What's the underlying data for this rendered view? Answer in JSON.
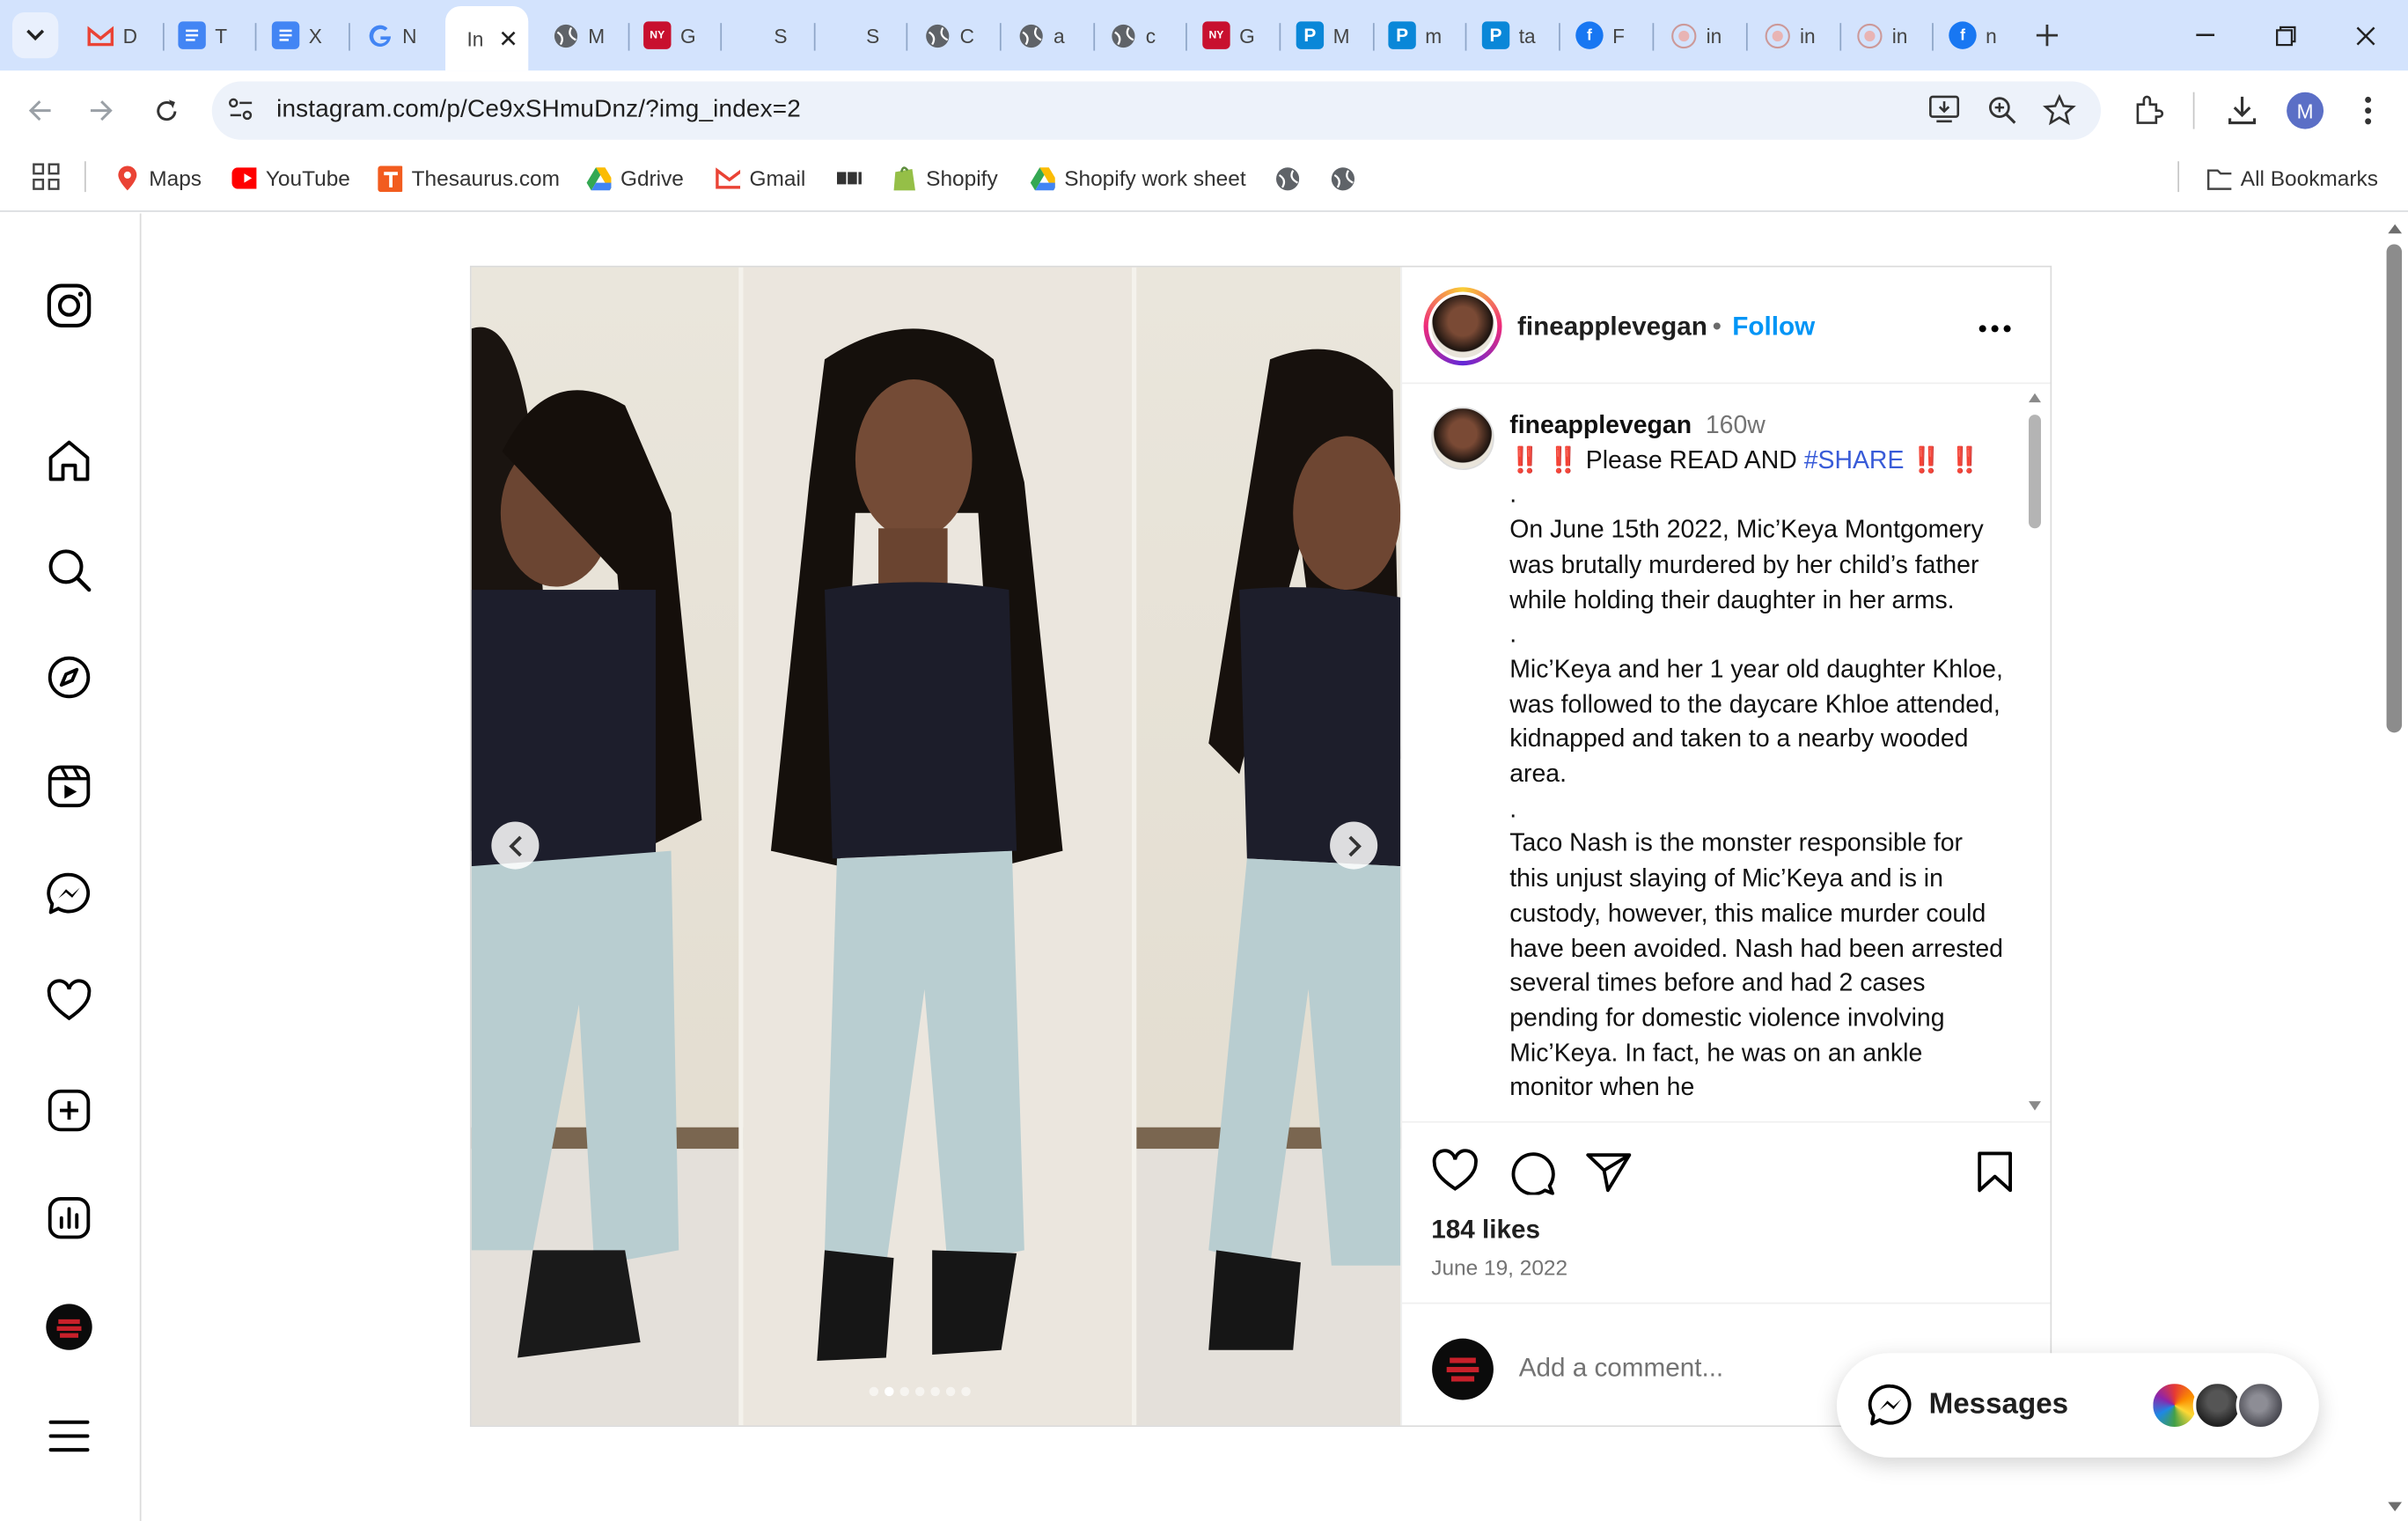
{
  "browser": {
    "tabs": [
      {
        "icon": "gmail-icon",
        "label": "D",
        "color": "#ea4335"
      },
      {
        "icon": "docs-icon",
        "label": "T",
        "color": "#4285f4"
      },
      {
        "icon": "docs-icon",
        "label": "X",
        "color": "#4285f4"
      },
      {
        "icon": "google-icon",
        "label": "N",
        "color": "#4285f4"
      },
      {
        "icon": "instagram-icon",
        "label": "In",
        "color": "#ffffff",
        "active": true
      },
      {
        "icon": "globe-icon",
        "label": "M",
        "color": "#5f6368"
      },
      {
        "icon": "nypost-icon",
        "label": "G",
        "color": "#c8102e"
      },
      {
        "icon": "blank-icon",
        "label": "S",
        "color": "#d3e3fd"
      },
      {
        "icon": "blank-icon",
        "label": "S",
        "color": "#d3e3fd"
      },
      {
        "icon": "globe-icon",
        "label": "C",
        "color": "#5f6368"
      },
      {
        "icon": "globe-icon",
        "label": "a",
        "color": "#5f6368"
      },
      {
        "icon": "globe-icon",
        "label": "c",
        "color": "#5f6368"
      },
      {
        "icon": "nypost-icon",
        "label": "G",
        "color": "#c8102e"
      },
      {
        "icon": "p-icon",
        "label": "M",
        "color": "#0a87d8"
      },
      {
        "icon": "p-icon",
        "label": "m",
        "color": "#0a87d8"
      },
      {
        "icon": "p-icon",
        "label": "ta",
        "color": "#0a87d8"
      },
      {
        "icon": "facebook-icon",
        "label": "F",
        "color": "#1877f2"
      },
      {
        "icon": "ig-gray-icon",
        "label": "in",
        "color": "#e0a0a0"
      },
      {
        "icon": "ig-gray-icon",
        "label": "in",
        "color": "#e0a0a0"
      },
      {
        "icon": "ig-gray-icon",
        "label": "in",
        "color": "#e0a0a0"
      },
      {
        "icon": "facebook-icon",
        "label": "n",
        "color": "#1877f2"
      }
    ],
    "url": "instagram.com/p/Ce9xSHmuDnz/?img_index=2",
    "profile_initial": "M",
    "bookmarks": [
      {
        "icon": "maps-icon",
        "label": "Maps"
      },
      {
        "icon": "youtube-icon",
        "label": "YouTube"
      },
      {
        "icon": "thesaurus-icon",
        "label": "Thesaurus.com"
      },
      {
        "icon": "gdrive-icon",
        "label": "Gdrive"
      },
      {
        "icon": "gmail-icon",
        "label": "Gmail"
      },
      {
        "icon": "bbc-icon",
        "label": ""
      },
      {
        "icon": "shopify-icon",
        "label": "Shopify"
      },
      {
        "icon": "gdrive-icon",
        "label": "Shopify work sheet"
      },
      {
        "icon": "globe-icon",
        "label": ""
      },
      {
        "icon": "globe-icon",
        "label": ""
      }
    ],
    "all_bookmarks": "All Bookmarks"
  },
  "post": {
    "username": "fineapplevegan",
    "follow": "Follow",
    "separator": "•",
    "caption_user": "fineapplevegan",
    "time_ago": "160w",
    "headline_emoji": "‼️ ‼️",
    "headline_text": "Please READ AND",
    "hashtag": "#SHARE",
    "headline_emoji_end": "‼️ ‼️",
    "caption_lines": [
      ".",
      "On June 15th 2022, Mic’Keya Montgomery was brutally murdered by her child’s father while holding their daughter in her arms.",
      ".",
      "Mic’Keya and her 1 year old daughter Khloe, was followed to the daycare Khloe attended, kidnapped and taken to a nearby wooded area.",
      ".",
      "Taco Nash is the monster responsible for this unjust slaying of Mic’Keya and is in custody, however, this malice murder could have been avoided. Nash had been arrested several times before and had 2 cases pending for domestic violence involving Mic’Keya. In fact, he was on an ankle monitor when he"
    ],
    "likes": "184 likes",
    "date": "June 19, 2022",
    "comment_placeholder": "Add a comment...",
    "carousel_total": 7,
    "carousel_index": 2
  },
  "messages": {
    "label": "Messages"
  },
  "colors": {
    "accent": "#0095f6",
    "hashtag": "#385bd8",
    "tabstrip": "#d3e3fd"
  }
}
